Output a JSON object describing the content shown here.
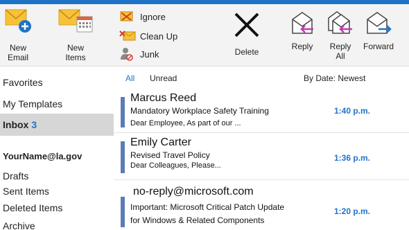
{
  "colors": {
    "accent": "#1f73c6",
    "unread_bar": "#5b7cb5",
    "selected_bg": "#d6d6d6"
  },
  "ribbon": {
    "new_email": {
      "label_line1": "New",
      "label_line2": "Email",
      "icon": "new-email-icon"
    },
    "new_items": {
      "label_line1": "New",
      "label_line2": "Items",
      "icon": "new-items-icon"
    },
    "ignore": {
      "label": "Ignore",
      "icon": "ignore-icon"
    },
    "clean_up": {
      "label": "Clean Up",
      "icon": "clean-up-icon"
    },
    "junk": {
      "label": "Junk",
      "icon": "junk-icon"
    },
    "delete": {
      "label": "Delete",
      "icon": "delete-x-icon"
    },
    "reply": {
      "label": "Reply",
      "icon": "reply-icon"
    },
    "reply_all": {
      "label_line1": "Reply",
      "label_line2": "All",
      "icon": "reply-all-icon"
    },
    "forward": {
      "label": "Forward",
      "icon": "forward-icon"
    }
  },
  "sidebar": {
    "favorites": "Favorites",
    "my_templates": "My Templates",
    "inbox": {
      "label": "Inbox",
      "count": "3"
    },
    "account": "YourName@la.gov",
    "folders": [
      "Drafts",
      "Sent Items",
      "Deleted Items",
      "Archive"
    ]
  },
  "filters": {
    "all": "All",
    "unread": "Unread",
    "sort": "By Date: Newest"
  },
  "messages": [
    {
      "sender": "Marcus Reed",
      "subject": "Mandatory Workplace Safety Training",
      "preview": "Dear Employee, As part of our ...",
      "time": "1:40 p.m."
    },
    {
      "sender": "Emily Carter",
      "subject": "Revised Travel Policy",
      "preview": "Dear Colleagues, Please...",
      "time": "1:36 p.m."
    },
    {
      "sender": "no-reply@microsoft.com",
      "subject": "Important: Microsoft Critical Patch Update",
      "preview": "for Windows & Related Components",
      "time": "1:20 p.m."
    }
  ]
}
